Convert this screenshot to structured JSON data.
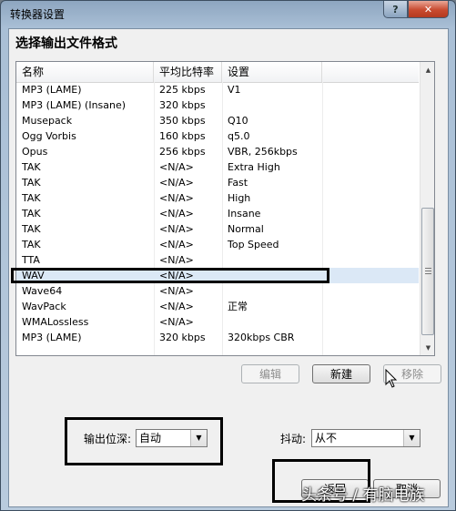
{
  "window": {
    "title": "转换器设置",
    "help_glyph": "?",
    "close_glyph": "✕"
  },
  "heading": "选择输出文件格式",
  "columns": [
    "名称",
    "平均比特率",
    "设置"
  ],
  "rows": [
    {
      "name": "MP3 (LAME)",
      "bitrate": "225 kbps",
      "setting": "V1"
    },
    {
      "name": "MP3 (LAME) (Insane)",
      "bitrate": "320 kbps",
      "setting": ""
    },
    {
      "name": "Musepack",
      "bitrate": "350 kbps",
      "setting": "Q10"
    },
    {
      "name": "Ogg Vorbis",
      "bitrate": "160 kbps",
      "setting": "q5.0"
    },
    {
      "name": "Opus",
      "bitrate": "256 kbps",
      "setting": "VBR, 256kbps"
    },
    {
      "name": "TAK",
      "bitrate": "<N/A>",
      "setting": "Extra High"
    },
    {
      "name": "TAK",
      "bitrate": "<N/A>",
      "setting": "Fast"
    },
    {
      "name": "TAK",
      "bitrate": "<N/A>",
      "setting": "High"
    },
    {
      "name": "TAK",
      "bitrate": "<N/A>",
      "setting": "Insane"
    },
    {
      "name": "TAK",
      "bitrate": "<N/A>",
      "setting": "Normal"
    },
    {
      "name": "TAK",
      "bitrate": "<N/A>",
      "setting": "Top Speed"
    },
    {
      "name": "TTA",
      "bitrate": "<N/A>",
      "setting": ""
    },
    {
      "name": "WAV",
      "bitrate": "<N/A>",
      "setting": "",
      "selected": true
    },
    {
      "name": "Wave64",
      "bitrate": "<N/A>",
      "setting": ""
    },
    {
      "name": "WavPack",
      "bitrate": "<N/A>",
      "setting": "正常"
    },
    {
      "name": "WMALossless",
      "bitrate": "<N/A>",
      "setting": ""
    },
    {
      "name": "MP3 (LAME)",
      "bitrate": "320 kbps",
      "setting": "320kbps CBR"
    }
  ],
  "buttons": {
    "edit": "编辑",
    "new": "新建",
    "remove": "移除",
    "ok": "返回",
    "cancel": "取消"
  },
  "output_depth": {
    "label": "输出位深:",
    "value": "自动"
  },
  "dither": {
    "label": "抖动:",
    "value": "从不"
  },
  "watermark": "头条号 / 有脑电族",
  "icons": {
    "combo_arrow": "▼",
    "scroll_up": "▲",
    "scroll_down": "▼"
  }
}
